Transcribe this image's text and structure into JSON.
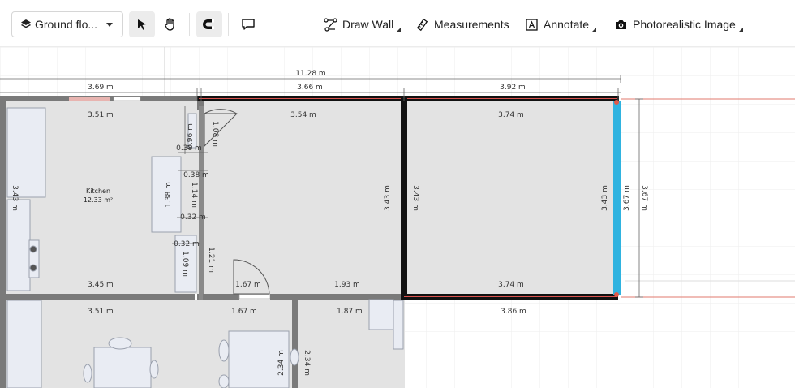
{
  "toolbar": {
    "floor_label": "Ground flo...",
    "draw_wall_label": "Draw Wall",
    "measurements_label": "Measurements",
    "annotate_label": "Annotate",
    "photoreal_label": "Photorealistic Image"
  },
  "icons": {
    "floor": "layers-icon",
    "select": "cursor-arrow-icon",
    "pan": "hand-icon",
    "snap": "magnet-icon",
    "comment": "comment-icon",
    "draw_wall": "polyline-icon",
    "measurements": "ruler-icon",
    "annotate": "text-box-icon",
    "photoreal": "camera-icon"
  },
  "plan": {
    "overall_width": "11.28 m",
    "top_dims": [
      "3.69 m",
      "3.66 m",
      "3.92 m"
    ],
    "kitchen": {
      "name": "Kitchen",
      "area": "12.33 m²",
      "top": "3.51 m",
      "bottom": "3.45 m",
      "left": "3.43 m"
    },
    "room_middle": {
      "top": "3.54 m",
      "right": "3.43 m",
      "bottom_a": "1.67 m",
      "bottom_b": "1.93 m",
      "door_h": "1.21 m"
    },
    "room_right": {
      "top": "3.74 m",
      "left": "3.43 m",
      "right": "3.43 m",
      "bottom": "3.74 m",
      "outer_a": "3.67 m",
      "outer_b": "3.67 m",
      "below": "3.86 m"
    },
    "closet": {
      "d1": "0.96 m",
      "d2": "1.08 m",
      "d3": "0.38 m",
      "d4": "0.38 m",
      "d5": "1.38 m",
      "d6": "1.14 m",
      "d7": "0.32 m",
      "d8": "0.32 m",
      "d9": "1.09 m"
    },
    "lower": {
      "a": "3.51 m",
      "b": "1.67 m",
      "c": "1.87 m",
      "d": "2.34 m",
      "e": "2.34 m"
    }
  }
}
